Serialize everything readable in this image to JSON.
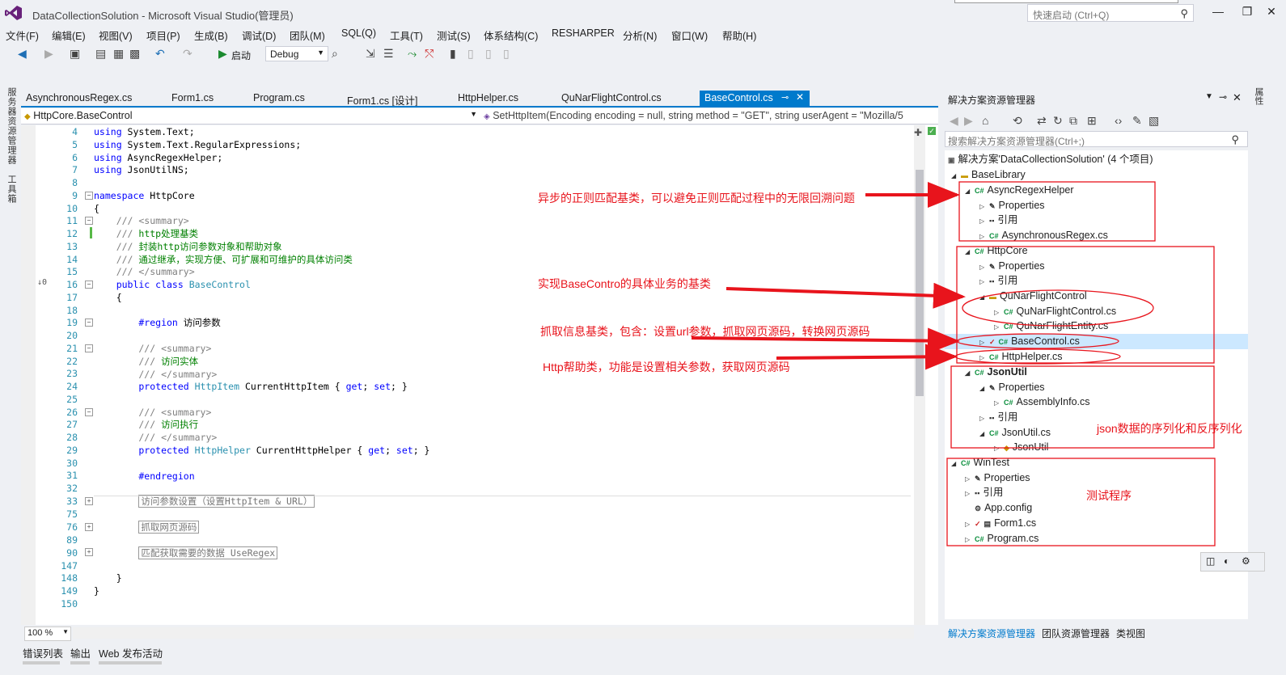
{
  "window": {
    "title": "DataCollectionSolution - Microsoft Visual Studio(管理员)",
    "quick_launch_placeholder": "快速启动 (Ctrl+Q)",
    "minimize": "—",
    "maximize": "❐",
    "close": "✕"
  },
  "menu": [
    "文件(F)",
    "编辑(E)",
    "视图(V)",
    "项目(P)",
    "生成(B)",
    "调试(D)",
    "团队(M)",
    "SQL(Q)",
    "工具(T)",
    "测试(S)",
    "体系结构(C)",
    "RESHARPER",
    "分析(N)",
    "窗口(W)",
    "帮助(H)"
  ],
  "toolbar": {
    "start_label": "启动",
    "config": "Debug"
  },
  "left_strip": {
    "server_explorer": "服务器资源管理器",
    "toolbox": "工具箱"
  },
  "tabs": [
    {
      "label": "AsynchronousRegex.cs"
    },
    {
      "label": "Form1.cs"
    },
    {
      "label": "Program.cs"
    },
    {
      "label": "Form1.cs [设计]"
    },
    {
      "label": "HttpHelper.cs"
    },
    {
      "label": "QuNarFlightControl.cs"
    },
    {
      "label": "BaseControl.cs"
    }
  ],
  "navbar": {
    "left": "HttpCore.BaseControl",
    "right": "SetHttpItem(Encoding encoding = null, string method = \"GET\", string userAgent = \"Mozilla/5"
  },
  "code": {
    "line_numbers": [
      "4",
      "5",
      "6",
      "7",
      "8",
      "9",
      "10",
      "11",
      "12",
      "13",
      "14",
      "15",
      "16",
      "17",
      "18",
      "19",
      "20",
      "21",
      "22",
      "23",
      "24",
      "25",
      "26",
      "27",
      "28",
      "29",
      "30",
      "31",
      "32",
      "33",
      "75",
      "76",
      "89",
      "90",
      "147",
      "148",
      "149",
      "150"
    ],
    "ref_marker": "↓0"
  },
  "editor": {
    "zoom": "100 %"
  },
  "bottom_tabs": [
    "错误列表",
    "输出",
    "Web 发布活动"
  ],
  "solution_explorer": {
    "title": "解决方案资源管理器",
    "search_placeholder": "搜索解决方案资源管理器(Ctrl+;)",
    "nodes": [
      {
        "label": "解决方案'DataCollectionSolution' (4 个项目)"
      },
      {
        "label": "BaseLibrary"
      },
      {
        "label": "AsyncRegexHelper"
      },
      {
        "label": "Properties"
      },
      {
        "label": "引用"
      },
      {
        "label": "AsynchronousRegex.cs"
      },
      {
        "label": "HttpCore"
      },
      {
        "label": "Properties"
      },
      {
        "label": "引用"
      },
      {
        "label": "QuNarFlightControl"
      },
      {
        "label": "QuNarFlightControl.cs"
      },
      {
        "label": "QuNarFlightEntity.cs"
      },
      {
        "label": "BaseControl.cs"
      },
      {
        "label": "HttpHelper.cs"
      },
      {
        "label": "JsonUtil"
      },
      {
        "label": "Properties"
      },
      {
        "label": "AssemblyInfo.cs"
      },
      {
        "label": "引用"
      },
      {
        "label": "JsonUtil.cs"
      },
      {
        "label": "JsonUtil"
      },
      {
        "label": "WinTest"
      },
      {
        "label": "Properties"
      },
      {
        "label": "引用"
      },
      {
        "label": "App.config"
      },
      {
        "label": "Form1.cs"
      },
      {
        "label": "Program.cs"
      }
    ],
    "bottom_tabs": [
      "解决方案资源管理器",
      "团队资源管理器",
      "类视图"
    ],
    "right_strip": "属性"
  },
  "annotations": [
    "异步的正则匹配基类，可以避免正则匹配过程中的无限回溯问题",
    "实现BaseContro的具体业务的基类",
    "抓取信息基类，包含：设置url参数，抓取网页源码，转换网页源码",
    "Http帮助类，功能是设置相关参数，获取网页源码",
    "json数据的序列化和反序列化",
    "测试程序"
  ],
  "colors": {
    "accent": "#007acc",
    "annotation": "#e8141c",
    "keyword": "#0000ff",
    "comment": "#008000",
    "type": "#2b91af"
  }
}
